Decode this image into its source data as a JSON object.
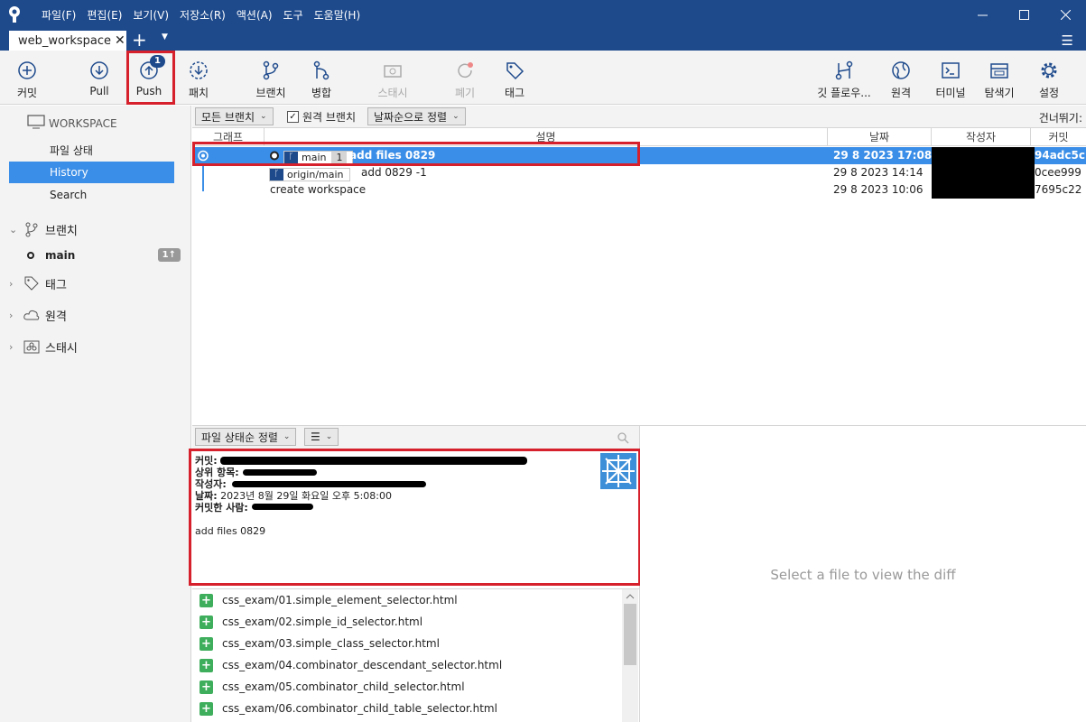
{
  "menu": [
    "파일(F)",
    "편집(E)",
    "보기(V)",
    "저장소(R)",
    "액션(A)",
    "도구",
    "도움말(H)"
  ],
  "tab": {
    "label": "web_workspace",
    "close": "✕",
    "add": "+"
  },
  "toolbar": {
    "commit": "커밋",
    "pull": "Pull",
    "push": "Push",
    "push_badge": "1",
    "fetch": "패치",
    "branch": "브랜치",
    "merge": "병합",
    "stash": "스태시",
    "discard": "폐기",
    "tag": "태그",
    "git_flow": "깃 플로우...",
    "remote": "원격",
    "terminal": "터미널",
    "explorer": "탐색기",
    "settings": "설정"
  },
  "sidebar": {
    "workspace": "WORKSPACE",
    "items": [
      "파일 상태",
      "History",
      "Search"
    ],
    "active": "History",
    "branches": "브랜치",
    "branch_main": "main",
    "branch_badge": "1↑",
    "tags": "태그",
    "remotes": "원격",
    "stashes": "스태시"
  },
  "filter": {
    "all_branches": "모든 브랜치",
    "remote_branches": "원격 브랜치",
    "sort_by_date": "날짜순으로 정렬",
    "skip": "건너뛰기:"
  },
  "columns": {
    "graph": "그래프",
    "description": "설명",
    "date": "날짜",
    "author": "작성자",
    "commit": "커밋"
  },
  "commits": [
    {
      "branch": "main",
      "branch_count": "1",
      "message": "add files 0829",
      "date": "29 8 2023 17:08",
      "hash": "94adc5c"
    },
    {
      "branch": "origin/main",
      "message": "add 0829 -1",
      "date": "29 8 2023 14:14",
      "hash": "0cee999"
    },
    {
      "message": "create workspace",
      "date": "29 8 2023 10:06",
      "hash": "7695c22"
    }
  ],
  "lower": {
    "sort_files": "파일 상태순 정렬",
    "list_icon": "☰"
  },
  "details": {
    "commit_label": "커밋:",
    "parents_label": "상위 항목:",
    "author_label": "작성자:",
    "date_label": "날짜:",
    "date_value": "2023년 8월 29일 화요일 오후 5:08:00",
    "committer_label": "커밋한 사람:",
    "message": "add files 0829"
  },
  "files": [
    "css_exam/01.simple_element_selector.html",
    "css_exam/02.simple_id_selector.html",
    "css_exam/03.simple_class_selector.html",
    "css_exam/04.combinator_descendant_selector.html",
    "css_exam/05.combinator_child_selector.html",
    "css_exam/06.combinator_child_table_selector.html"
  ],
  "diff": {
    "placeholder": "Select a file to view the diff"
  },
  "colors": {
    "titlebar": "#1e4a8c",
    "accent": "#3b8ee7",
    "highlight": "#d6202b",
    "added": "#3fae5c"
  }
}
